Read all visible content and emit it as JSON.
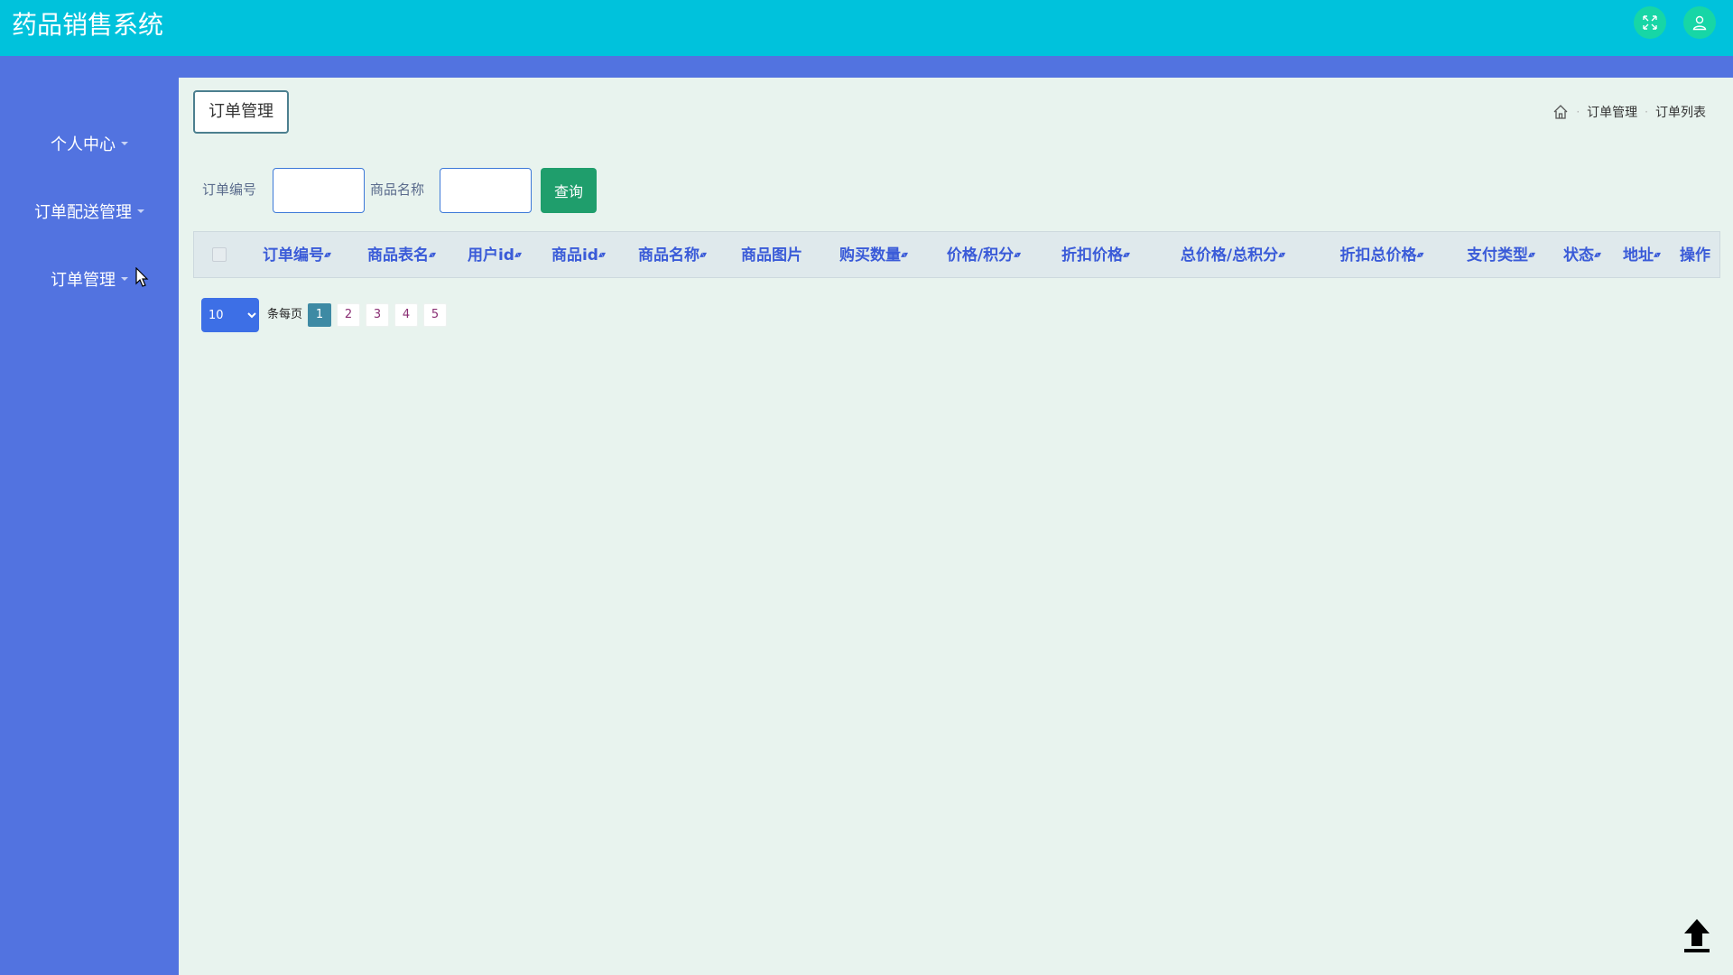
{
  "header": {
    "title": "药品销售系统",
    "fullscreen_icon": "fullscreen-icon",
    "user_icon": "user-icon"
  },
  "sidebar": {
    "items": [
      {
        "label": "个人中心"
      },
      {
        "label": "订单配送管理"
      },
      {
        "label": "订单管理"
      }
    ]
  },
  "page": {
    "title_button": "订单管理",
    "breadcrumb": [
      "订单管理",
      "订单列表"
    ]
  },
  "search": {
    "order_no_label": "订单编号",
    "order_no_value": "",
    "product_name_label": "商品名称",
    "product_name_value": "",
    "query_button": "查询"
  },
  "table": {
    "columns": [
      {
        "label": "订单编号",
        "sortable": true
      },
      {
        "label": "商品表名",
        "sortable": true
      },
      {
        "label": "用户id",
        "sortable": true
      },
      {
        "label": "商品id",
        "sortable": true
      },
      {
        "label": "商品名称",
        "sortable": true
      },
      {
        "label": "商品图片",
        "sortable": false
      },
      {
        "label": "购买数量",
        "sortable": true
      },
      {
        "label": "价格/积分",
        "sortable": true
      },
      {
        "label": "折扣价格",
        "sortable": true
      },
      {
        "label": "总价格/总积分",
        "sortable": true
      },
      {
        "label": "折扣总价格",
        "sortable": true
      },
      {
        "label": "支付类型",
        "sortable": true
      },
      {
        "label": "状态",
        "sortable": true
      },
      {
        "label": "地址",
        "sortable": true
      },
      {
        "label": "操作",
        "sortable": false
      }
    ],
    "rows": []
  },
  "pagination": {
    "page_size": "10",
    "per_page_label": "条每页",
    "pages": [
      "1",
      "2",
      "3",
      "4",
      "5"
    ],
    "current_page": "1"
  },
  "colors": {
    "header_bg": "#00c2dc",
    "sidebar_bg": "#5273e0",
    "main_bg": "#e8f3ee",
    "query_button_bg": "#1f9e6c",
    "column_header_text": "#3a5bd8"
  }
}
